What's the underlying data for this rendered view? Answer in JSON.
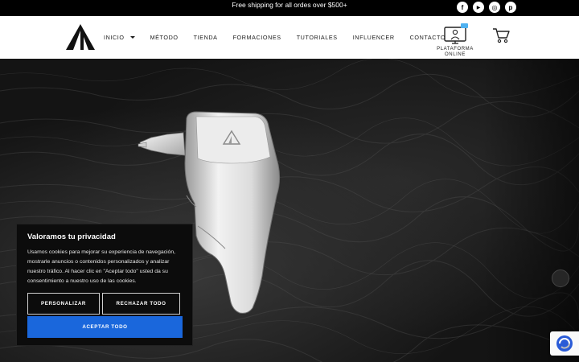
{
  "topbar": {
    "shipping_text": "Free shipping for all ordes over $500+",
    "socials": [
      {
        "icon": "facebook-icon",
        "glyph": "f"
      },
      {
        "icon": "youtube-icon",
        "glyph": "▶"
      },
      {
        "icon": "instagram-icon",
        "glyph": "◎"
      },
      {
        "icon": "pinterest-icon",
        "glyph": "p"
      }
    ]
  },
  "header": {
    "nav": [
      {
        "label": "INICIO",
        "has_dropdown": true
      },
      {
        "label": "MÉTODO"
      },
      {
        "label": "TIENDA"
      },
      {
        "label": "FORMACIONES"
      },
      {
        "label": "TUTORIALES"
      },
      {
        "label": "INFLUENCER"
      },
      {
        "label": "CONTACTO"
      }
    ],
    "platform_label_line1": "PLATAFORMA",
    "platform_label_line2": "ONLINE"
  },
  "cookie": {
    "title": "Valoramos tu privacidad",
    "text": "Usamos cookies para mejorar su experiencia de navegación, mostrarle anuncios o contenidos personalizados y analizar nuestro tráfico. Al hacer clic en \"Aceptar todo\" usted da su consentimiento a nuestro uso de las cookies.",
    "customize_label": "PERSONALIZAR",
    "reject_label": "RECHAZAR TODO",
    "accept_label": "ACEPTAR TODO"
  },
  "colors": {
    "accent": "#1a67dc",
    "topbar": "#000000",
    "header": "#ffffff"
  }
}
